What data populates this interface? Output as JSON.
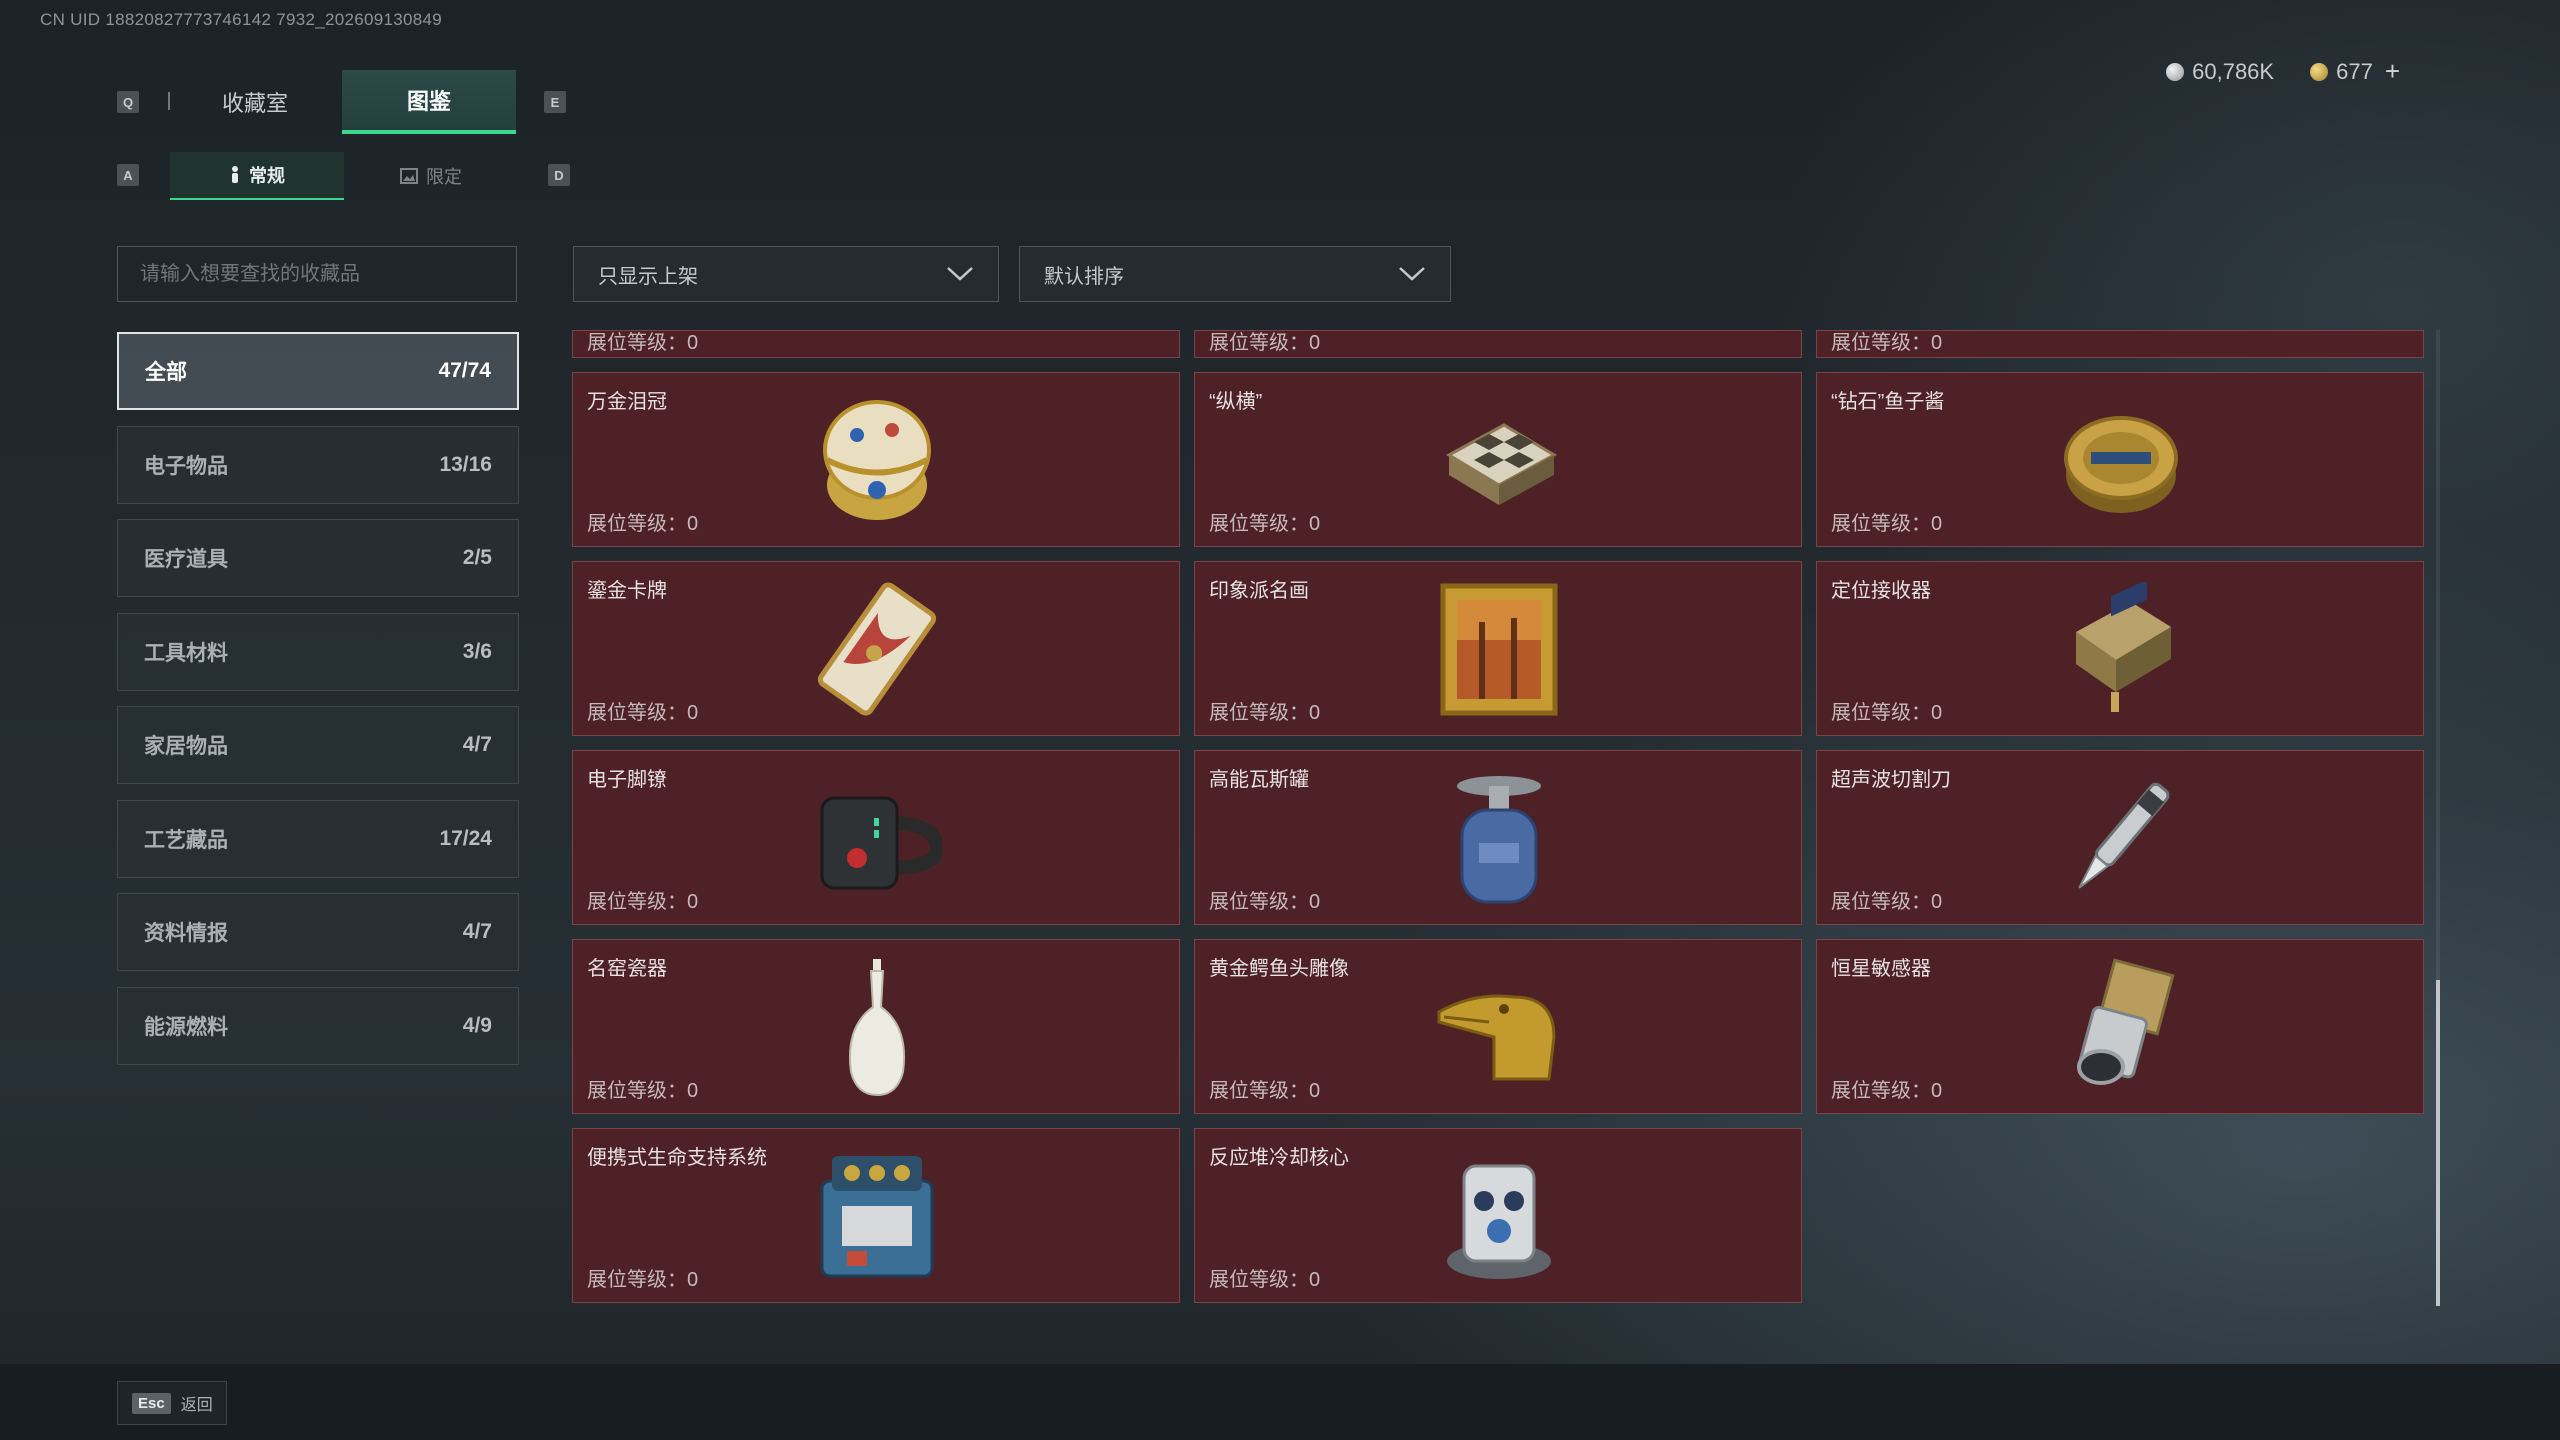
{
  "uid": "CN UID 18820827773746142 7932_202609130849",
  "keys": {
    "prev_tab": "Q",
    "next_tab": "E",
    "prev_sub": "A",
    "next_sub": "D"
  },
  "tabs": [
    {
      "label": "收藏室"
    },
    {
      "label": "图鉴"
    }
  ],
  "subtabs": [
    {
      "label": "常规"
    },
    {
      "label": "限定"
    }
  ],
  "currency": {
    "silver": "60,786K",
    "gold": "677",
    "add": "+"
  },
  "search": {
    "placeholder": "请输入想要查找的收藏品"
  },
  "categories": [
    {
      "name": "全部",
      "count": "47/74"
    },
    {
      "name": "电子物品",
      "count": "13/16"
    },
    {
      "name": "医疗道具",
      "count": "2/5"
    },
    {
      "name": "工具材料",
      "count": "3/6"
    },
    {
      "name": "家居物品",
      "count": "4/7"
    },
    {
      "name": "工艺藏品",
      "count": "17/24"
    },
    {
      "name": "资料情报",
      "count": "4/7"
    },
    {
      "name": "能源燃料",
      "count": "4/9"
    }
  ],
  "filters": {
    "shelf": "只显示上架",
    "sort": "默认排序"
  },
  "level_label": "展位等级：",
  "partial_row": [
    {
      "level": "0"
    },
    {
      "level": "0"
    },
    {
      "level": "0"
    }
  ],
  "items": [
    {
      "name": "万金泪冠",
      "level": "0",
      "icon": "jeweled-egg-icon"
    },
    {
      "name": "“纵横”",
      "level": "0",
      "icon": "chessboard-icon"
    },
    {
      "name": "“钻石”鱼子酱",
      "level": "0",
      "icon": "caviar-tin-icon"
    },
    {
      "name": "鎏金卡牌",
      "level": "0",
      "icon": "gold-card-icon"
    },
    {
      "name": "印象派名画",
      "level": "0",
      "icon": "framed-painting-icon"
    },
    {
      "name": "定位接收器",
      "level": "0",
      "icon": "receiver-device-icon"
    },
    {
      "name": "电子脚镣",
      "level": "0",
      "icon": "ankle-monitor-icon"
    },
    {
      "name": "高能瓦斯罐",
      "level": "0",
      "icon": "gas-canister-icon"
    },
    {
      "name": "超声波切割刀",
      "level": "0",
      "icon": "ultrasonic-knife-icon"
    },
    {
      "name": "名窑瓷器",
      "level": "0",
      "icon": "porcelain-vase-icon"
    },
    {
      "name": "黄金鳄鱼头雕像",
      "level": "0",
      "icon": "gold-crocodile-icon"
    },
    {
      "name": "恒星敏感器",
      "level": "0",
      "icon": "star-sensor-icon"
    },
    {
      "name": "便携式生命支持系统",
      "level": "0",
      "icon": "life-support-icon"
    },
    {
      "name": "反应堆冷却核心",
      "level": "0",
      "icon": "reactor-core-icon"
    }
  ],
  "footer": {
    "esc_key": "Esc",
    "back_label": "返回"
  },
  "colors": {
    "accent": "#3fd68e",
    "card_bg": "#4e2126",
    "card_border": "#7b444b"
  }
}
